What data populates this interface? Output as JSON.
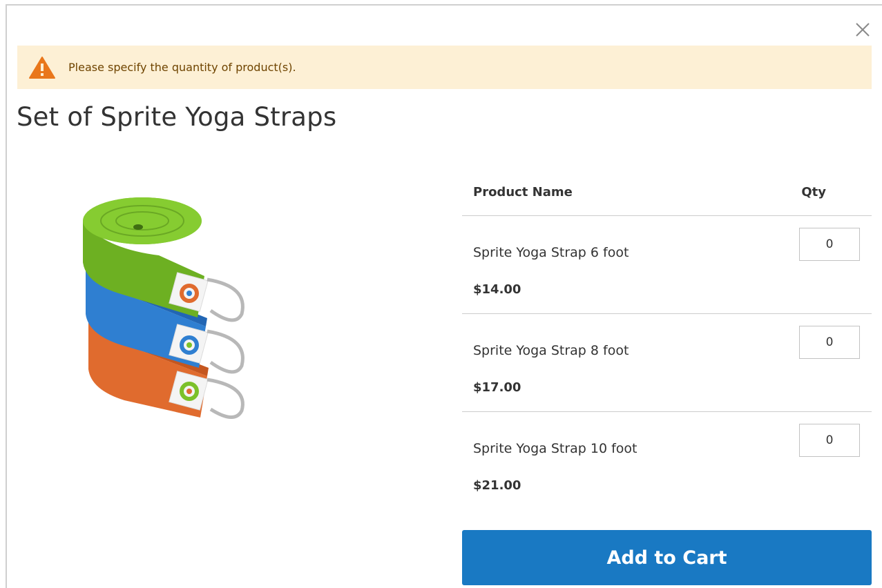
{
  "modal": {
    "close_label": "×",
    "message": {
      "text": "Please specify the quantity of product(s).",
      "icon": "warning-triangle-icon",
      "icon_color": "#e9771b",
      "background": "#fdf0d5"
    },
    "title": "Set of Sprite Yoga Straps",
    "product_image": {
      "icon": "yoga-straps-image",
      "colors": [
        "#7cc12a",
        "#2f7fd1",
        "#e06b2e"
      ]
    },
    "table": {
      "headers": {
        "name": "Product Name",
        "qty": "Qty"
      },
      "rows": [
        {
          "name": "Sprite Yoga Strap 6 foot",
          "price": "$14.00",
          "qty": "0"
        },
        {
          "name": "Sprite Yoga Strap 8 foot",
          "price": "$17.00",
          "qty": "0"
        },
        {
          "name": "Sprite Yoga Strap 10 foot",
          "price": "$21.00",
          "qty": "0"
        }
      ]
    },
    "add_to_cart_label": "Add to Cart",
    "accent_color": "#1979c3"
  }
}
